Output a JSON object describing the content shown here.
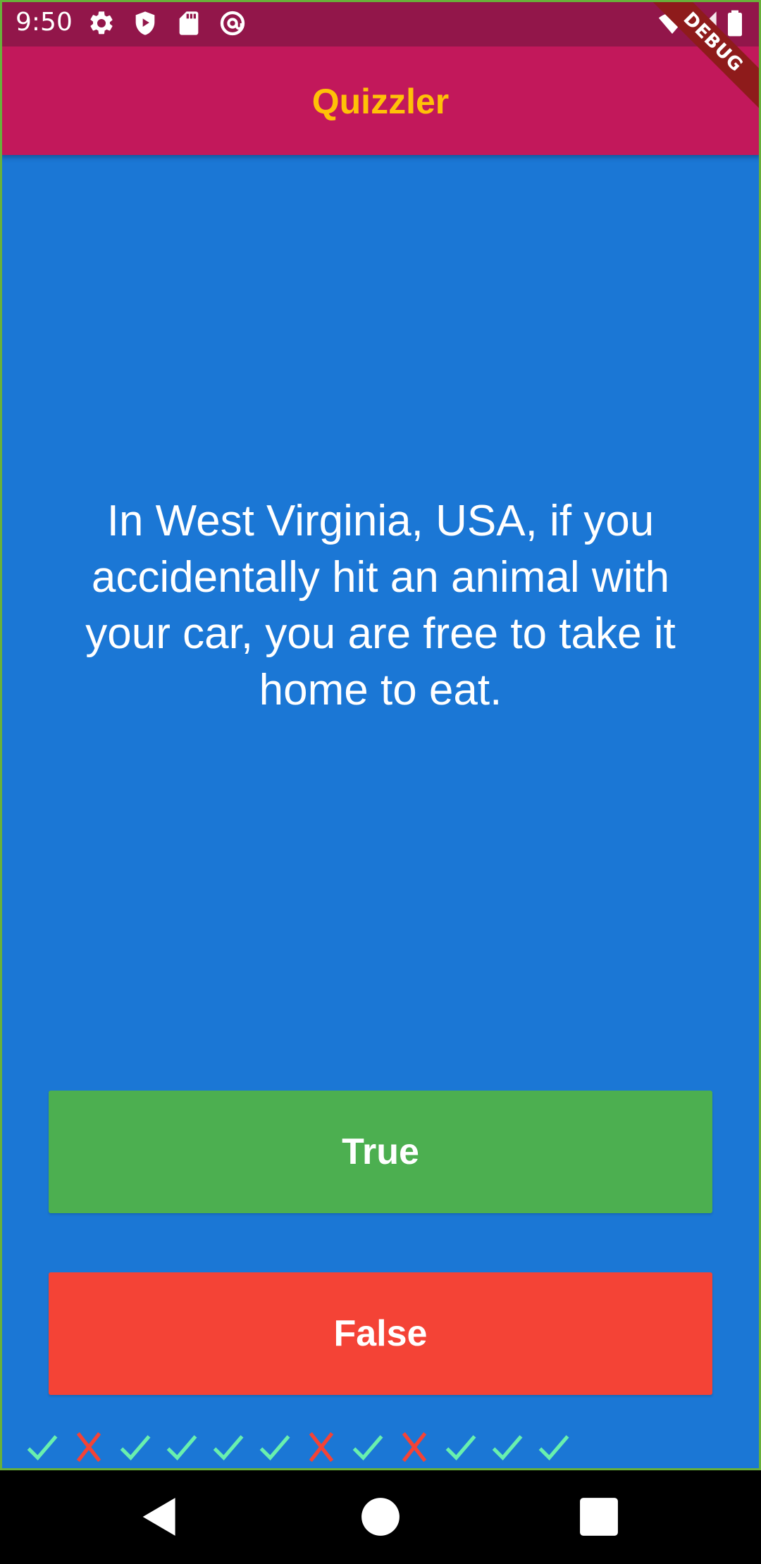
{
  "status_bar": {
    "time": "9:50",
    "left_icons": [
      "gear-icon",
      "play-shield-icon",
      "sd-card-icon",
      "at-sign-icon"
    ],
    "right_icons": [
      "wifi-icon",
      "signal-icon",
      "battery-icon"
    ]
  },
  "app_bar": {
    "title": "Quizzler",
    "title_color": "#ffc107",
    "background_color": "#c2185b"
  },
  "debug_banner": {
    "label": "DEBUG"
  },
  "question": {
    "text": "In West Virginia, USA, if you accidentally hit an animal with your car, you are free to take it home to eat."
  },
  "buttons": {
    "true_label": "True",
    "false_label": "False",
    "true_color": "#4caf50",
    "false_color": "#f44336"
  },
  "score_keeper": {
    "results": [
      "check",
      "cross",
      "check",
      "check",
      "check",
      "check",
      "cross",
      "check",
      "cross",
      "check",
      "check",
      "check"
    ],
    "check_color": "#69f0ae",
    "cross_color": "#f44336"
  },
  "nav_bar": {
    "buttons": [
      "back-icon",
      "home-icon",
      "recents-icon"
    ]
  },
  "colors": {
    "body_background": "#1b77d5",
    "status_bar": "#92164a"
  }
}
